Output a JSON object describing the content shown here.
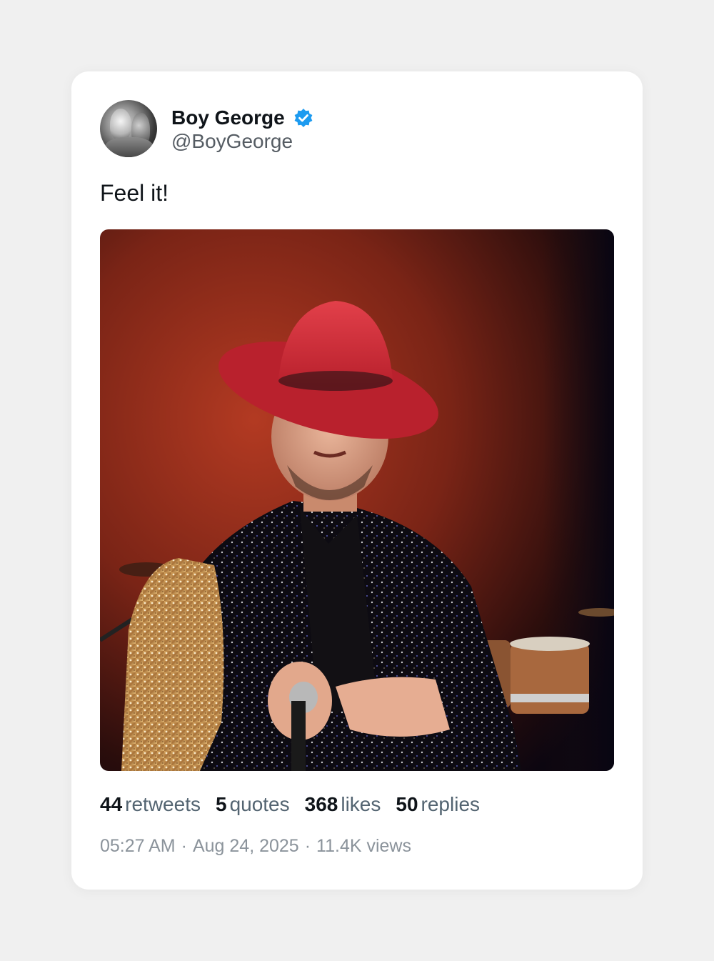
{
  "user": {
    "name": "Boy George",
    "handle": "@BoyGeorge",
    "verified": true,
    "avatar_icon": "profile-photo-avatar"
  },
  "tweet": {
    "text": "Feel it!",
    "media_icon": "concert-photo-performer-in-red-hat"
  },
  "stats": [
    {
      "value": "44",
      "label": "retweets"
    },
    {
      "value": "5",
      "label": "quotes"
    },
    {
      "value": "368",
      "label": "likes"
    },
    {
      "value": "50",
      "label": "replies"
    }
  ],
  "meta": {
    "time": "05:27 AM",
    "date": "Aug 24, 2025",
    "views": "11.4K views"
  },
  "colors": {
    "background": "#f0f0f0",
    "card": "#ffffff",
    "verified": "#1d9bf0",
    "text": "#0f1419",
    "muted": "#536471"
  }
}
